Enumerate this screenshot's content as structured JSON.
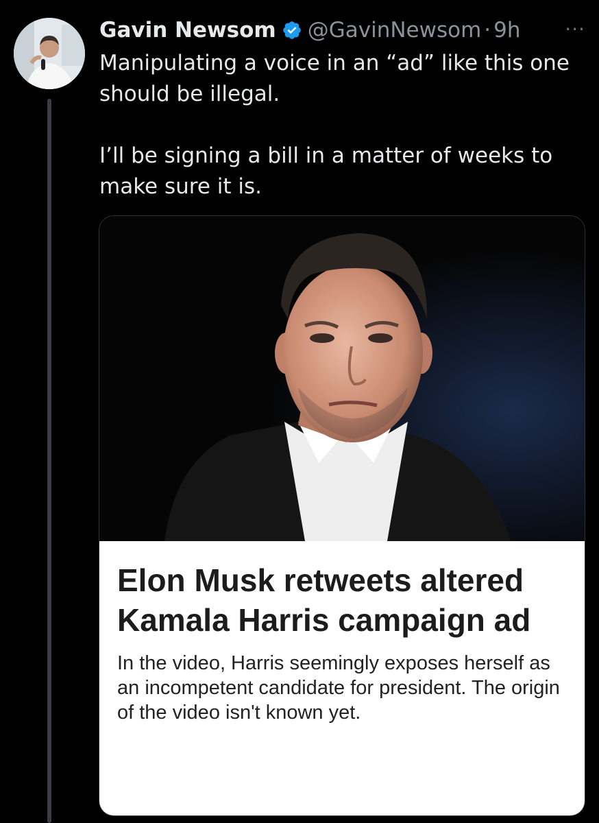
{
  "tweet": {
    "author_name": "Gavin Newsom",
    "handle": "@GavinNewsom",
    "separator": "·",
    "time": "9h",
    "more_label": "···",
    "text_line1": "Manipulating a voice in an “ad” like this one should be illegal.",
    "text_line2": "I’ll be signing a bill in a matter of weeks to make sure it is."
  },
  "card": {
    "headline": "Elon Musk retweets altered Kamala Harris campaign ad",
    "subhead": "In the video, Harris seemingly exposes herself as an incompetent candidate for president. The origin of the video isn't known yet."
  },
  "colors": {
    "background": "#000000",
    "verified_badge": "#1d9bf0",
    "secondary_text": "#8b9299"
  }
}
